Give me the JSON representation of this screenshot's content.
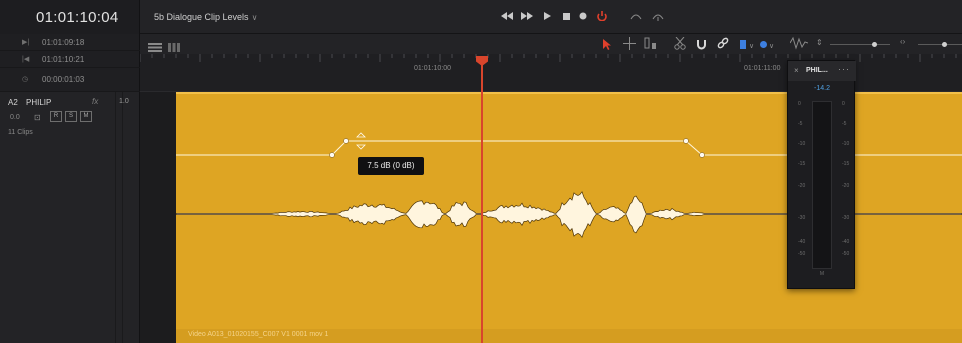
{
  "timecode": {
    "current": "01:01:10:04"
  },
  "timeline": {
    "name": "5b Dialogue Clip Levels"
  },
  "left_info": {
    "rows": [
      {
        "icon": "mark-in-icon",
        "value": "01:01:09:18"
      },
      {
        "icon": "mark-out-icon",
        "value": "01:01:10:21"
      },
      {
        "icon": "duration-icon",
        "value": "00:00:01:03"
      }
    ]
  },
  "ruler": {
    "labels": [
      "01:01:10:00",
      "01:01:11:00"
    ]
  },
  "track": {
    "id": "A2",
    "name": "PHILIP",
    "fx_label": "fx",
    "channel": "1.0",
    "volume": "0.0",
    "buttons": [
      "R",
      "S",
      "M"
    ],
    "clip_count": "11 Clips"
  },
  "clip": {
    "label": "Video  A013_01020155_C007  V1  0001  mov  1"
  },
  "tooltip": {
    "text": "7.5 dB (0 dB)"
  },
  "meter": {
    "name": "PHIL...",
    "peak": "-14.2",
    "scale": [
      "0",
      "-5",
      "-10",
      "-15",
      "-20",
      "-30",
      "-40",
      "-50"
    ],
    "footer": "M"
  },
  "colors": {
    "clip": "#dea523",
    "playhead": "#d8452c",
    "accent_blue": "#4f9fe0"
  }
}
